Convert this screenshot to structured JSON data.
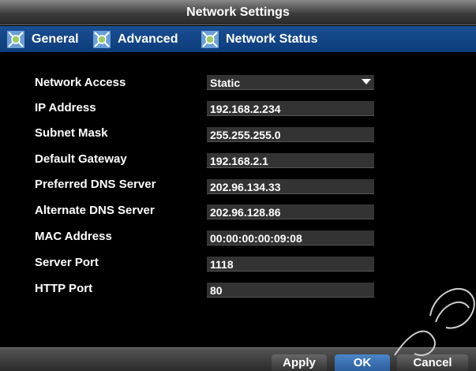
{
  "window": {
    "title": "Network Settings"
  },
  "tabs": [
    {
      "label": "General",
      "icon": "network-tab-icon",
      "active": true
    },
    {
      "label": "Advanced",
      "icon": "network-tab-icon",
      "active": false
    },
    {
      "label": "Network Status",
      "icon": "network-tab-icon",
      "active": false
    }
  ],
  "form": {
    "network_access": {
      "label": "Network Access",
      "value": "Static"
    },
    "ip_address": {
      "label": "IP Address",
      "value": "192.168.2.234"
    },
    "subnet_mask": {
      "label": "Subnet Mask",
      "value": "255.255.255.0"
    },
    "default_gateway": {
      "label": "Default Gateway",
      "value": "192.168.2.1"
    },
    "preferred_dns": {
      "label": "Preferred DNS Server",
      "value": "202.96.134.33"
    },
    "alternate_dns": {
      "label": "Alternate DNS Server",
      "value": "202.96.128.86"
    },
    "mac_address": {
      "label": "MAC Address",
      "value": "00:00:00:00:09:08"
    },
    "server_port": {
      "label": "Server Port",
      "value": "1118"
    },
    "http_port": {
      "label": "HTTP Port",
      "value": "80"
    }
  },
  "buttons": {
    "apply": "Apply",
    "ok": "OK",
    "cancel": "Cancel"
  },
  "colors": {
    "tab_bar": "#0d3c7a",
    "ok_button": "#3a73b8",
    "field_bg": "#333333"
  }
}
